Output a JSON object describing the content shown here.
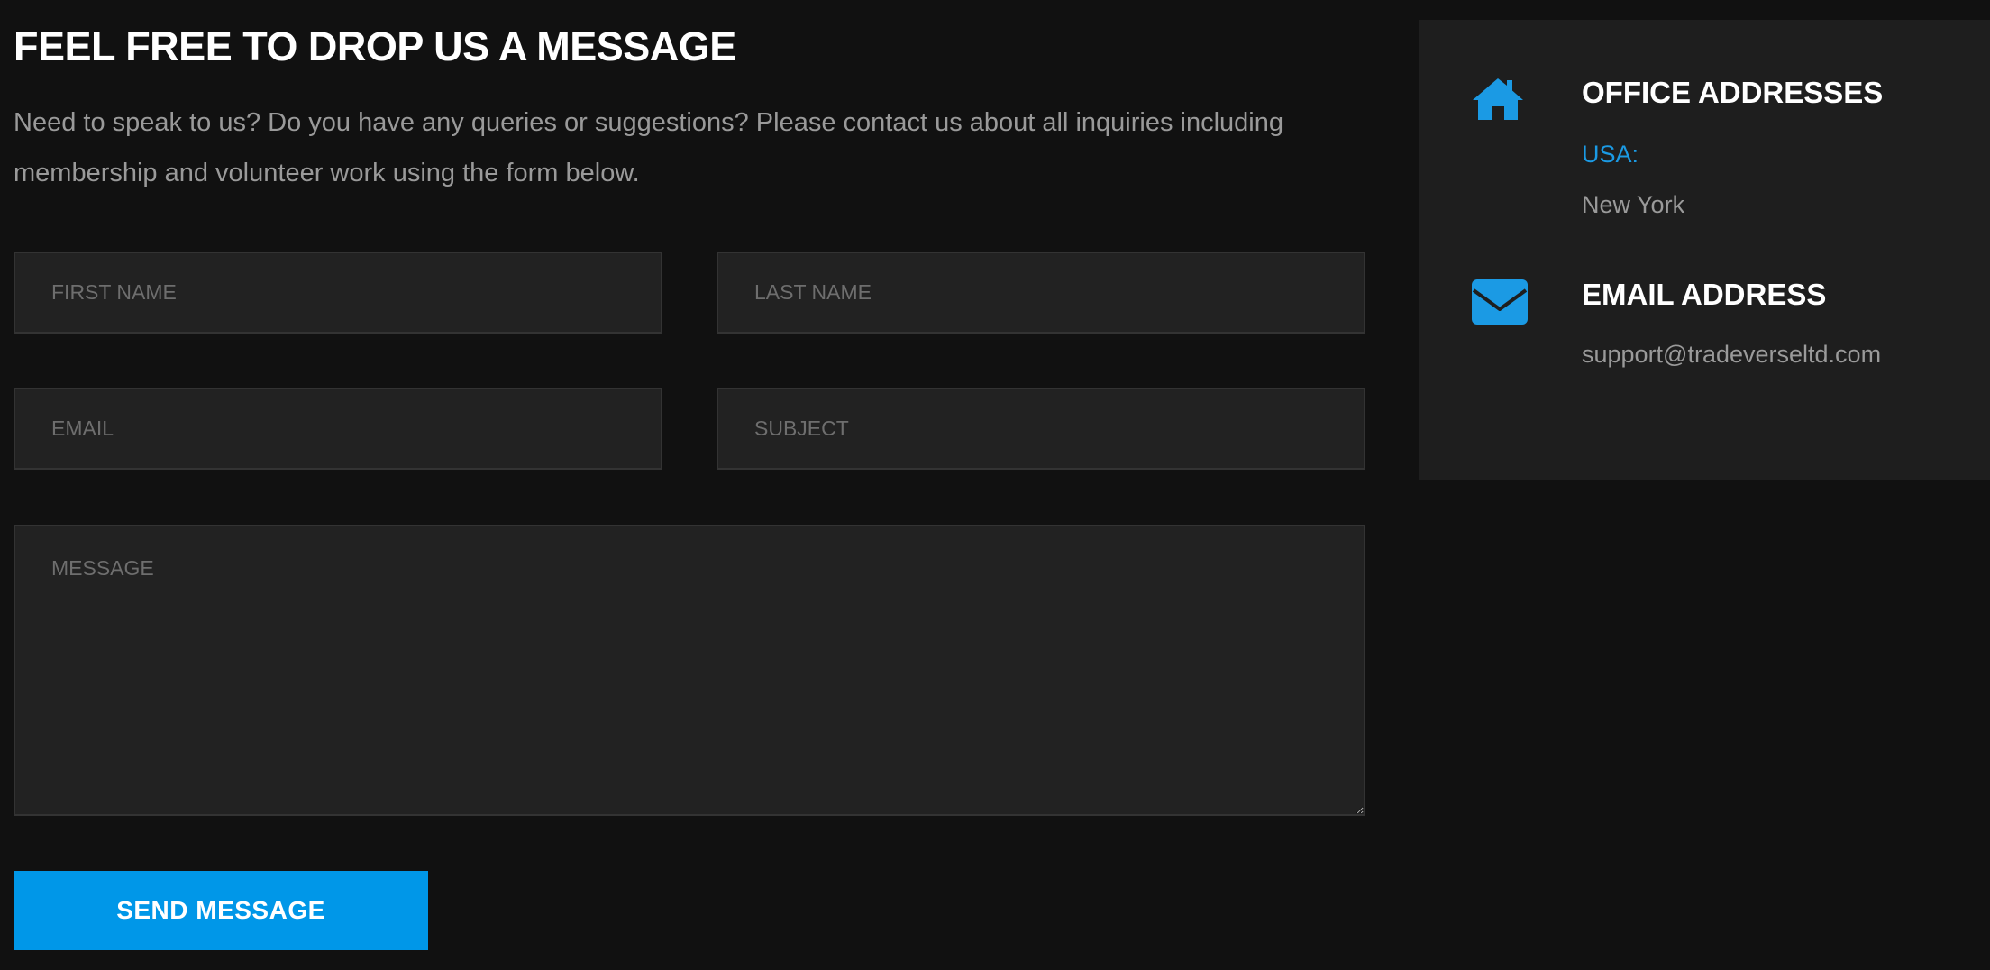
{
  "form": {
    "title": "FEEL FREE TO DROP US A MESSAGE",
    "intro": "Need to speak to us? Do you have any queries or suggestions? Please contact us about all inquiries including membership and volunteer work using the form below.",
    "first_name_placeholder": "FIRST NAME",
    "last_name_placeholder": "LAST NAME",
    "email_placeholder": "EMAIL",
    "subject_placeholder": "SUBJECT",
    "message_placeholder": "MESSAGE",
    "send_label": "SEND MESSAGE"
  },
  "info": {
    "office_heading": "OFFICE ADDRESSES",
    "office_region": "USA:",
    "office_city": "New York",
    "email_heading": "EMAIL ADDRESS",
    "email_value": "support@tradeverseltd.com",
    "home_icon": "home-icon",
    "mail_icon": "envelope-icon"
  },
  "colors": {
    "background": "#111111",
    "panel": "#1e1e1e",
    "field": "#222222",
    "accent": "#0097e8",
    "link": "#1b9ae4"
  }
}
